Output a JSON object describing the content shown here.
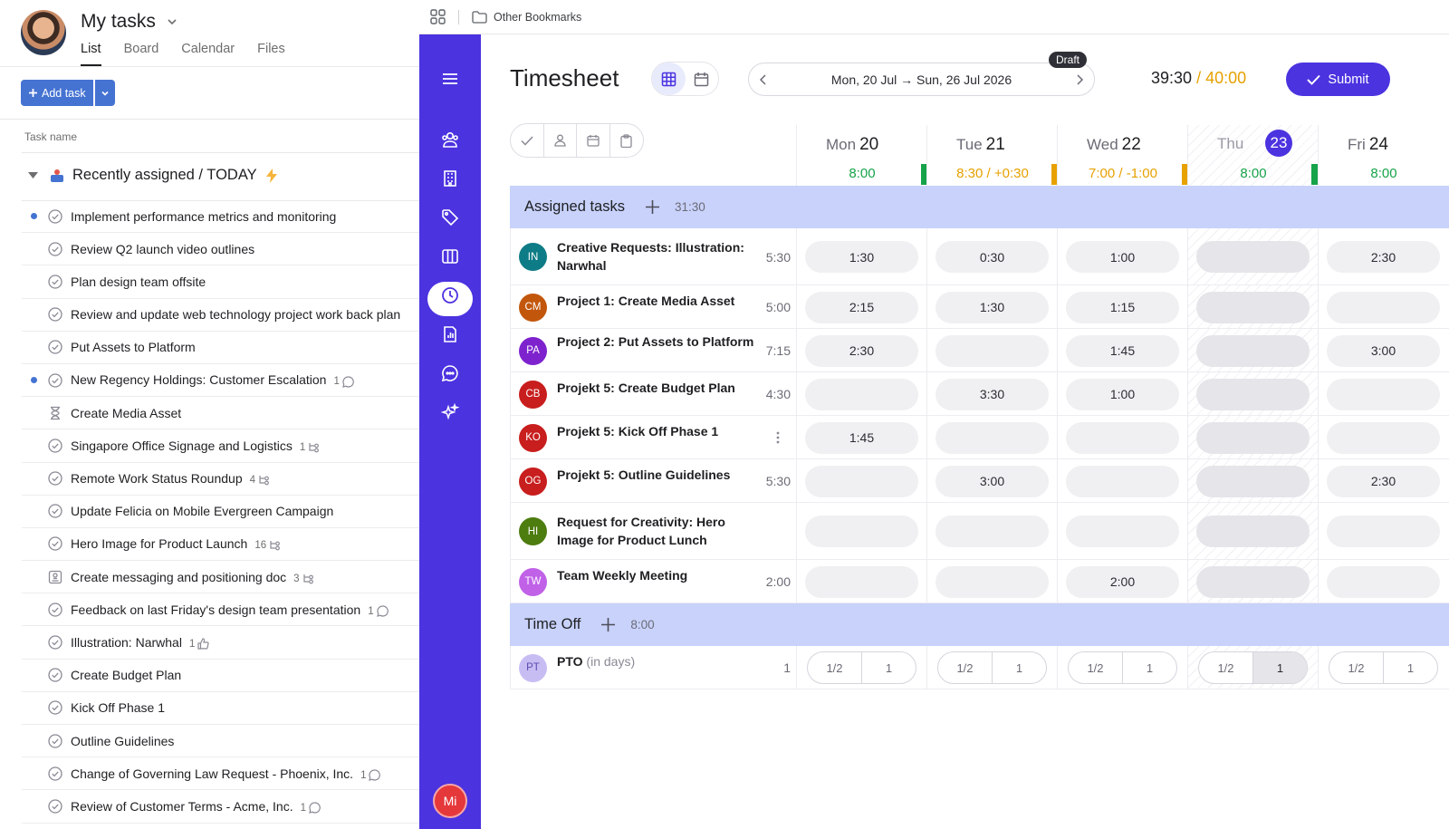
{
  "left": {
    "title": "My tasks",
    "tabs": [
      "List",
      "Board",
      "Calendar",
      "Files"
    ],
    "add_task_label": "Add task",
    "column_header": "Task name",
    "section_title": "Recently assigned / TODAY",
    "tasks": [
      {
        "name": "Implement performance metrics and monitoring",
        "dot": true,
        "icon": "check-circle-icon",
        "meta": ""
      },
      {
        "name": "Review Q2 launch video outlines",
        "dot": false,
        "icon": "check-circle-icon",
        "meta": ""
      },
      {
        "name": "Plan design team offsite",
        "dot": false,
        "icon": "check-circle-icon",
        "meta": ""
      },
      {
        "name": "Review and update web technology project work back plan",
        "dot": false,
        "icon": "check-circle-icon",
        "meta": ""
      },
      {
        "name": "Put Assets to Platform",
        "dot": false,
        "icon": "check-circle-icon",
        "meta": ""
      },
      {
        "name": "New Regency Holdings: Customer Escalation",
        "dot": true,
        "icon": "check-circle-icon",
        "meta": "1",
        "meta_icon": "comment-icon"
      },
      {
        "name": "Create Media Asset",
        "dot": false,
        "icon": "hourglass-icon",
        "meta": ""
      },
      {
        "name": "Singapore Office Signage and Logistics",
        "dot": false,
        "icon": "check-circle-icon",
        "meta": "1",
        "meta_icon": "subtask-icon"
      },
      {
        "name": "Remote Work Status Roundup",
        "dot": false,
        "icon": "check-circle-icon",
        "meta": "4",
        "meta_icon": "subtask-icon"
      },
      {
        "name": "Update Felicia on Mobile Evergreen Campaign",
        "dot": false,
        "icon": "check-circle-icon",
        "meta": ""
      },
      {
        "name": "Hero Image for Product Launch",
        "dot": false,
        "icon": "check-circle-icon",
        "meta": "16",
        "meta_icon": "subtask-icon"
      },
      {
        "name": "Create messaging and positioning doc",
        "dot": false,
        "icon": "approval-icon",
        "meta": "3",
        "meta_icon": "subtask-icon"
      },
      {
        "name": "Feedback on last Friday's design team presentation",
        "dot": false,
        "icon": "check-circle-icon",
        "meta": "1",
        "meta_icon": "comment-icon"
      },
      {
        "name": "Illustration: Narwhal",
        "dot": false,
        "icon": "check-circle-icon",
        "meta": "1",
        "meta_icon": "like-icon"
      },
      {
        "name": "Create Budget Plan",
        "dot": false,
        "icon": "check-circle-icon",
        "meta": ""
      },
      {
        "name": "Kick Off Phase 1",
        "dot": false,
        "icon": "check-circle-icon",
        "meta": ""
      },
      {
        "name": "Outline Guidelines",
        "dot": false,
        "icon": "check-circle-icon",
        "meta": ""
      },
      {
        "name": "Change of Governing Law Request - Phoenix, Inc.",
        "dot": false,
        "icon": "check-circle-icon",
        "meta": "1",
        "meta_icon": "comment-icon"
      },
      {
        "name": "Review of Customer Terms - Acme, Inc.",
        "dot": false,
        "icon": "check-circle-icon",
        "meta": "1",
        "meta_icon": "comment-icon"
      }
    ]
  },
  "bookmarks": {
    "folder": "Other Bookmarks"
  },
  "rail": {
    "icons": [
      "menu-icon",
      "team-icon",
      "building-icon",
      "tag-icon",
      "board-icon",
      "clock-icon",
      "report-icon",
      "chat-icon",
      "sparkle-icon"
    ],
    "active": "clock-icon",
    "user_initials": "Mi"
  },
  "timesheet": {
    "title": "Timesheet",
    "range": "Mon, 20 Jul → Sun, 26 Jul 2026",
    "status_badge": "Draft",
    "total_done": "39:30",
    "total_sep": "/",
    "total_goal": "40:00",
    "submit_label": "Submit",
    "colors": {
      "accent": "#4b33e0",
      "ok": "#16a34a",
      "warn": "#e7a100",
      "band": "#c8d2fb"
    },
    "days": [
      {
        "dow": "Mon",
        "date": "20",
        "hours": "8:00",
        "status": "ok",
        "today": false
      },
      {
        "dow": "Tue",
        "date": "21",
        "hours": "8:30 / +0:30",
        "status": "warn",
        "today": false
      },
      {
        "dow": "Wed",
        "date": "22",
        "hours": "7:00 / -1:00",
        "status": "warn",
        "today": false
      },
      {
        "dow": "Thu",
        "date": "23",
        "hours": "8:00",
        "status": "ok",
        "today": true
      },
      {
        "dow": "Fri",
        "date": "24",
        "hours": "8:00",
        "status": "ok",
        "today": false
      }
    ],
    "assigned": {
      "title": "Assigned tasks",
      "total": "31:30",
      "rows": [
        {
          "initials": "IN",
          "color": "#0e7c86",
          "name": "Creative Requests: Illustration: Narwhal",
          "total": "5:30",
          "cells": [
            "1:30",
            "0:30",
            "1:00",
            "",
            "2:30"
          ]
        },
        {
          "initials": "CM",
          "color": "#c2570c",
          "name": "Project 1: Create Media Asset",
          "total": "5:00",
          "cells": [
            "2:15",
            "1:30",
            "1:15",
            "",
            ""
          ]
        },
        {
          "initials": "PA",
          "color": "#7e22ce",
          "name": "Project 2: Put Assets to Platform",
          "total": "7:15",
          "cells": [
            "2:30",
            "",
            "1:45",
            "",
            "3:00"
          ]
        },
        {
          "initials": "CB",
          "color": "#c81e1e",
          "name": "Projekt 5: Create Budget Plan",
          "total": "4:30",
          "cells": [
            "",
            "3:30",
            "1:00",
            "",
            ""
          ]
        },
        {
          "initials": "KO",
          "color": "#c81e1e",
          "name": "Projekt 5: Kick Off Phase 1",
          "total": "",
          "cells": [
            "1:45",
            "",
            "",
            "",
            ""
          ],
          "menu": true
        },
        {
          "initials": "OG",
          "color": "#c81e1e",
          "name": "Projekt 5: Outline Guidelines",
          "total": "5:30",
          "cells": [
            "",
            "3:00",
            "",
            "",
            "2:30"
          ]
        },
        {
          "initials": "HI",
          "color": "#4d7c0f",
          "name": "Request for Creativity: Hero Image for Product Lunch",
          "total": "",
          "cells": [
            "",
            "",
            "",
            "",
            ""
          ]
        },
        {
          "initials": "TW",
          "color": "#c061e8",
          "name": "Team Weekly Meeting",
          "total": "2:00",
          "cells": [
            "",
            "",
            "2:00",
            "",
            ""
          ]
        }
      ]
    },
    "timeoff": {
      "title": "Time Off",
      "total": "8:00",
      "rows": [
        {
          "initials": "PT",
          "color": "#c8bdf3",
          "name": "PTO",
          "sub": "(in days)",
          "total": "1",
          "half": "1/2",
          "full": "1",
          "selected_day": 3
        }
      ]
    }
  }
}
